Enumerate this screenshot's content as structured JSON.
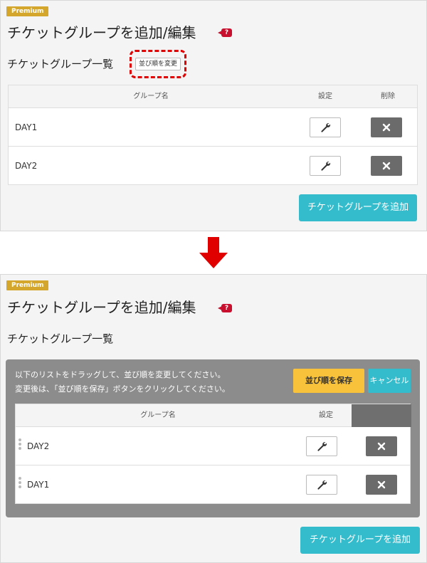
{
  "before": {
    "badge": "Premium",
    "title": "チケットグループを追加/編集",
    "help_label": "?",
    "subtitle": "チケットグループ一覧",
    "reorder_button": "並び順を変更",
    "table": {
      "headers": {
        "name": "グループ名",
        "settings": "設定",
        "delete": "削除"
      },
      "rows": [
        {
          "name": "DAY1"
        },
        {
          "name": "DAY2"
        }
      ]
    },
    "add_button": "チケットグループを追加"
  },
  "after": {
    "badge": "Premium",
    "title": "チケットグループを追加/編集",
    "help_label": "?",
    "subtitle": "チケットグループ一覧",
    "instructions": [
      "以下のリストをドラッグして、並び順を変更してください。",
      "変更後は、「並び順を保存」ボタンをクリックしてください。"
    ],
    "save_button": "並び順を保存",
    "cancel_button": "キャンセル",
    "table": {
      "headers": {
        "name": "グループ名",
        "settings": "設定"
      },
      "rows": [
        {
          "name": "DAY2"
        },
        {
          "name": "DAY1"
        }
      ]
    },
    "add_button": "チケットグループを追加"
  },
  "colors": {
    "badge": "#d4a72c",
    "accent": "#35bccc",
    "save": "#f8c23a",
    "highlight": "#e00000",
    "arrow": "#e00000",
    "delete": "#6b6b6b"
  },
  "icons": [
    "help-icon",
    "wrench-icon",
    "close-icon",
    "drag-handle-icon",
    "down-arrow-icon"
  ]
}
